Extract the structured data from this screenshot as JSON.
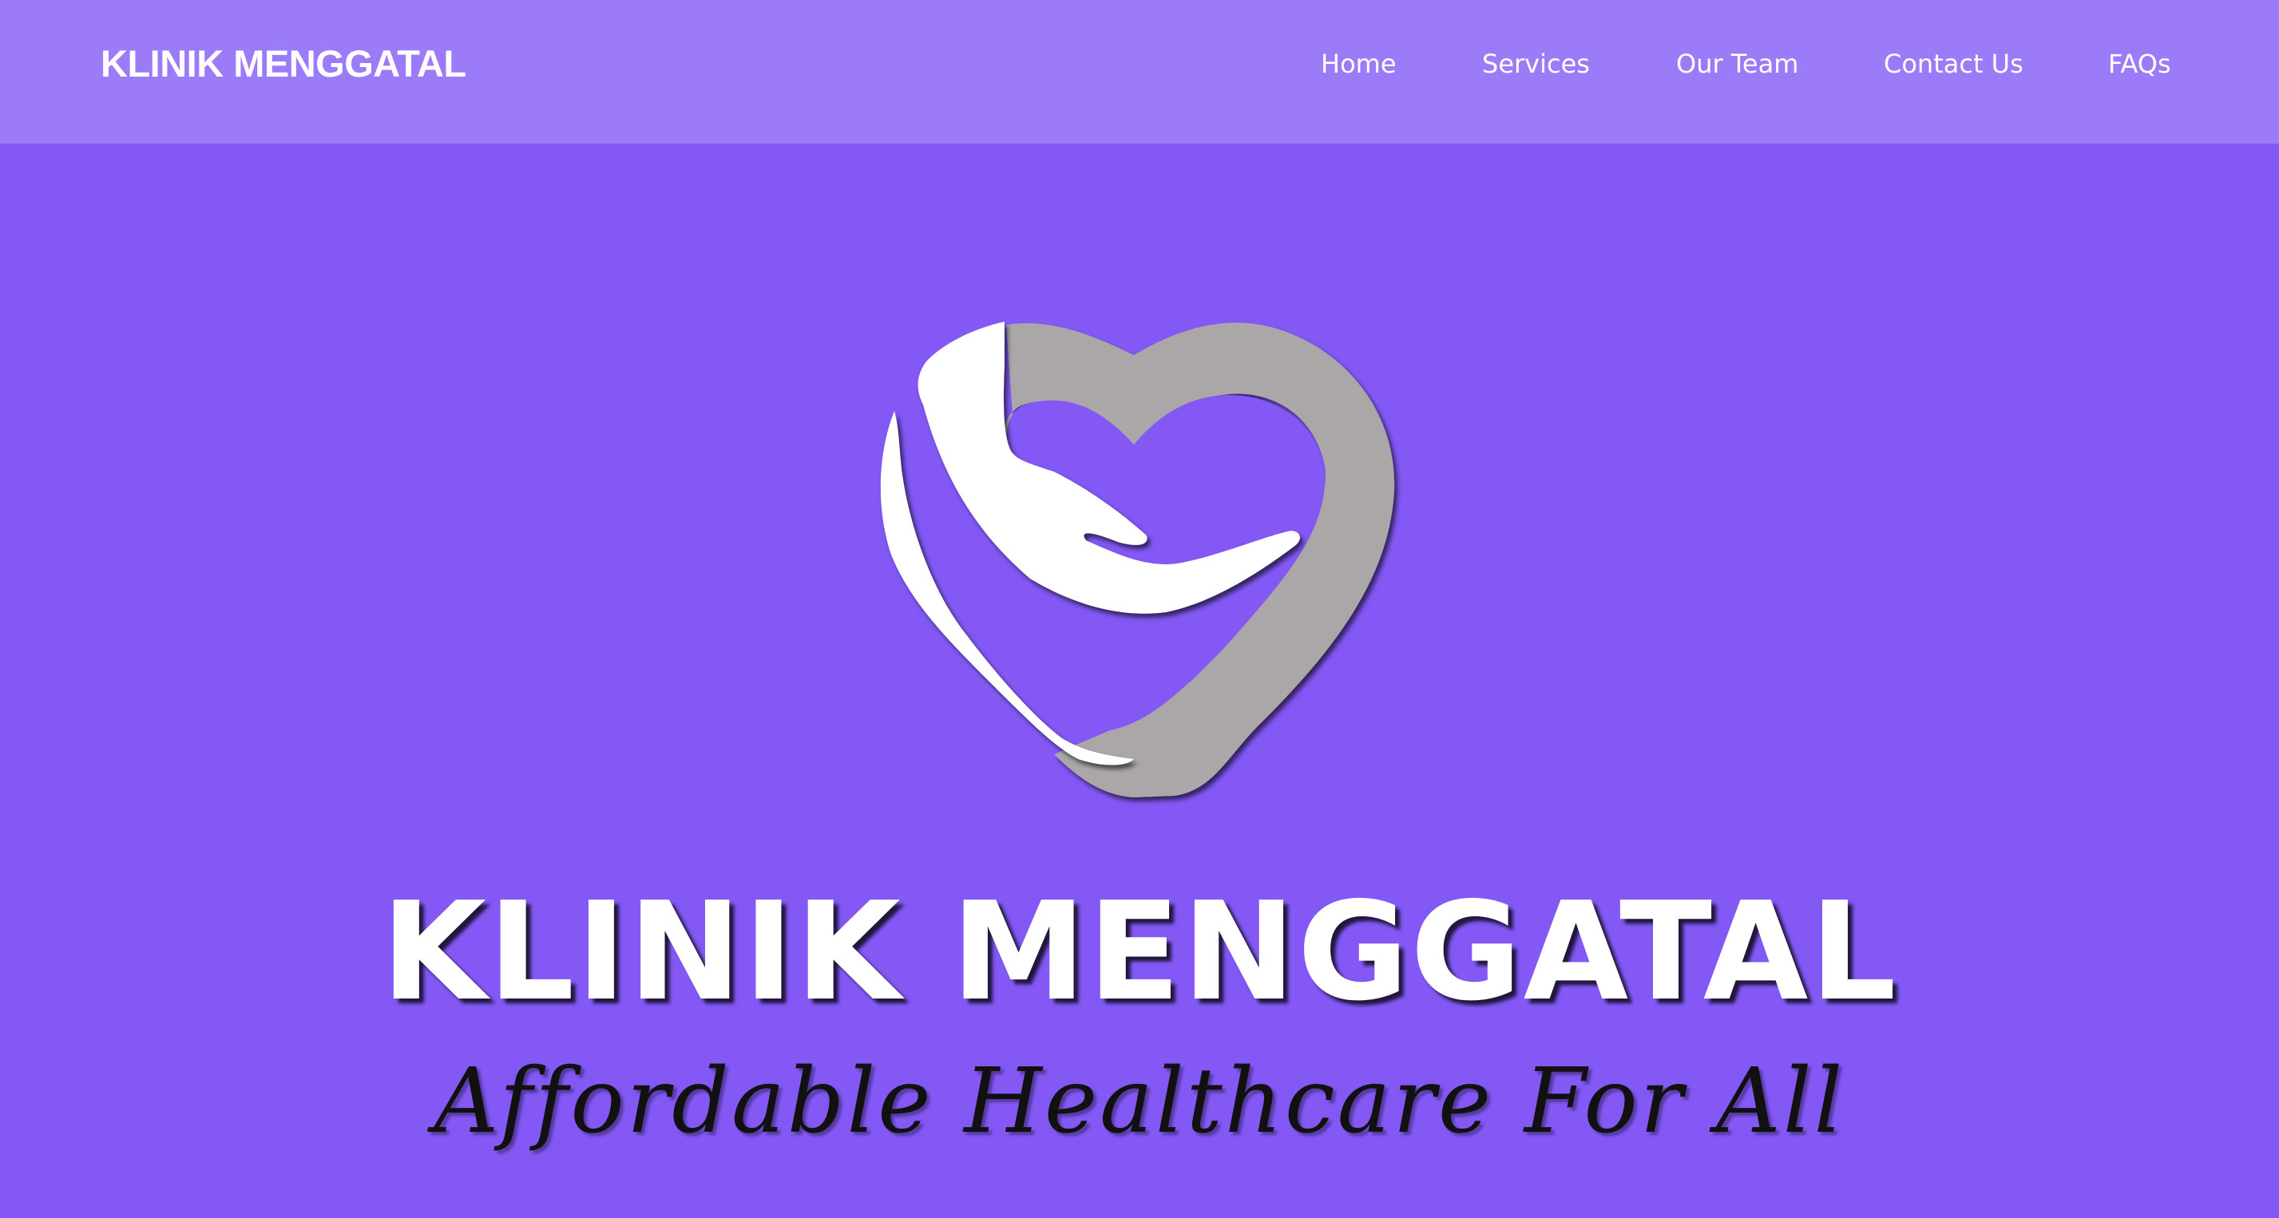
{
  "navbar": {
    "brand": "KLINIK MENGGATAL",
    "links": [
      "Home",
      "Services",
      "Our Team",
      "Contact Us",
      "FAQs"
    ]
  },
  "hero": {
    "title": "KLINIK MENGGATAL",
    "tagline": "Affordable Healthcare For All",
    "logo_icon": "heart-hands-icon"
  },
  "colors": {
    "navbar_bg": "#9b7bf8",
    "hero_bg": "#8358f5",
    "logo_hand": "#ffffff",
    "logo_heart": "#aba7a9",
    "title_text": "#ffffff",
    "tagline_text": "#111111"
  }
}
